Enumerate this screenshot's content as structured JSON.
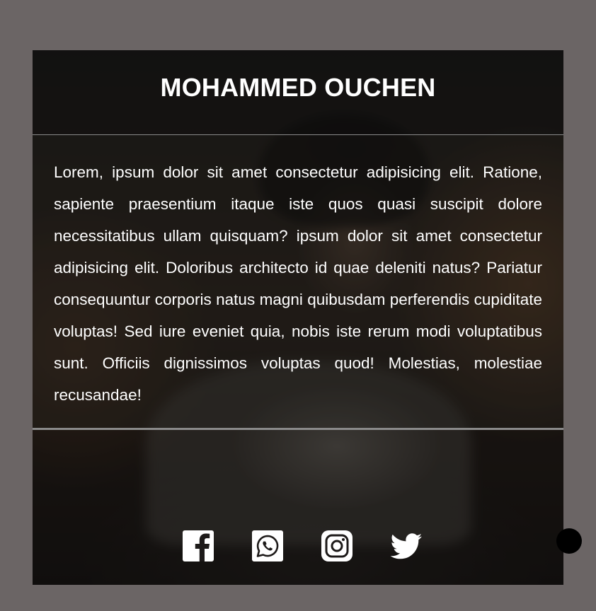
{
  "profile": {
    "name": "MOHAMMED OUCHEN",
    "bio": "Lorem, ipsum dolor sit amet consectetur adipisicing elit. Ratione, sapiente praesentium itaque iste quos quasi suscipit dolore necessitatibus ullam quisquam? ipsum dolor sit amet consectetur adipisicing elit. Doloribus architecto id quae deleniti natus? Pariatur consequuntur corporis natus magni quibusdam perferendis cupiditate voluptas! Sed iure eveniet quia, nobis iste rerum modi voluptatibus sunt. Officiis dignissimos voluptas quod! Molestias, molestiae recusandae!"
  },
  "socials": [
    {
      "icon": "facebook-icon"
    },
    {
      "icon": "whatsapp-icon"
    },
    {
      "icon": "instagram-icon"
    },
    {
      "icon": "twitter-icon"
    }
  ],
  "colors": {
    "page_background": "#6b6565",
    "text": "#ffffff",
    "divider": "#8a8a8a",
    "icon_fill": "#ffffff",
    "floating_dot": "#000000"
  }
}
